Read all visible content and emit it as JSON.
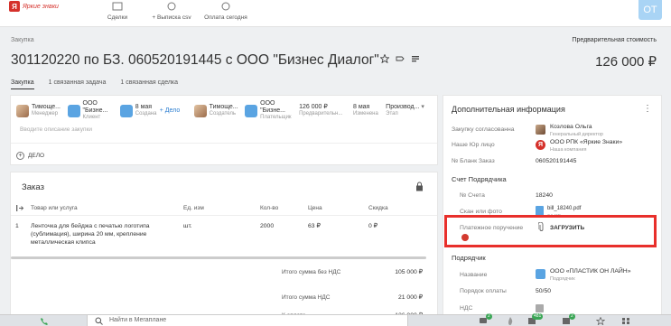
{
  "app": {
    "logo_text": "Яркие знаки",
    "logo_letter": "Я",
    "nav": [
      {
        "label": "Сделки",
        "icon": "deals-icon"
      },
      {
        "label": "+ Выписка csv",
        "icon": "globe-icon"
      },
      {
        "label": "Оплата сегодня",
        "icon": "dollar-icon"
      }
    ],
    "user_initials": "ОТ"
  },
  "header": {
    "breadcrumb": "Закупка",
    "title": "301120220 по БЗ. 060520191445 с ООО \"Бизнес Диалог\"",
    "pre_cost_label": "Предварительная стоимость",
    "price": "126 000 ₽",
    "tabs": [
      "Закупка",
      "1 связанная задача",
      "1 связанная сделка"
    ]
  },
  "participants": [
    {
      "name": "Тимоще...",
      "role": "Менеджер",
      "avatar": "photo"
    },
    {
      "name": "ООО \"Бизне...",
      "role": "Клиент",
      "avatar": "company"
    },
    {
      "name": "8 мая",
      "role": "Создана",
      "avatar": "calendar"
    },
    {
      "name": "Тимоще...",
      "role": "Создатель",
      "avatar": "photo"
    },
    {
      "name": "ООО \"Бизне...",
      "role": "Плательщик",
      "avatar": "company"
    },
    {
      "name": "126 000 ₽",
      "role": "Предварительн...",
      "avatar": "none"
    },
    {
      "name": "8 мая",
      "role": "Изменена",
      "avatar": "none"
    },
    {
      "name": "Производ...",
      "role": "Этап",
      "avatar": "none"
    }
  ],
  "add_deal_link": "+ Дело",
  "description_placeholder": "Вводите описание закупки",
  "deal_button": "ДЕЛО",
  "order": {
    "title": "Заказ",
    "columns": [
      "№",
      "Товар или услуга",
      "Ед. изм",
      "Кол-во",
      "Цена",
      "Скидка"
    ],
    "rows": [
      {
        "num": "1",
        "product": "Ленточка для бейджа с печатью логотипа (сублимация), ширина 20 мм, крепление металлическая клипса",
        "unit": "шт.",
        "qty": "2000",
        "price": "63 ₽",
        "discount": "0 ₽"
      }
    ],
    "totals": [
      {
        "label": "Итого сумма без НДС",
        "value": "105 000 ₽"
      },
      {
        "label": "Итого сумма НДС",
        "value": "21 000 ₽"
      },
      {
        "label": "К оплате",
        "value": "126 000 ₽"
      }
    ]
  },
  "info": {
    "title": "Дополнительная информация",
    "approved_label": "Закупку согласованна",
    "approved_name": "Козлова Ольга",
    "approved_role": "Генеральный директор",
    "legal_label": "Наше Юр лицо",
    "legal_name": "ООО РПК «Яркие Знаки»",
    "legal_sub": "Наша компания",
    "blank_label": "№ Бланк Заказ",
    "blank_value": "060520191445",
    "supplier_invoice_title": "Счет Подрядчика",
    "invoice_num_label": "№ Счета",
    "invoice_num_value": "18240",
    "scan_label": "Скан или фото",
    "scan_file": "bill_18240.pdf",
    "scan_size": "64 KB",
    "payment_label": "Платежное поручение",
    "upload_label": "ЗАГРУЗИТЬ",
    "contractor_title": "Подрядчик",
    "contractor_name_label": "Название",
    "contractor_name": "ООО «ПЛАСТИК ОН ЛАЙН»",
    "contractor_sub": "Подрядчик",
    "pay_order_label": "Порядок оплаты",
    "pay_order_value": "50/50",
    "vat_label": "НДС"
  },
  "bottom": {
    "search_placeholder": "Найти в Мегаплане",
    "badge_a": "2",
    "badge_b": "481",
    "badge_c": "2"
  },
  "colors": {
    "accent": "#2e7fd1",
    "brand_red": "#d5312b",
    "highlight_red": "#e82f2b"
  }
}
